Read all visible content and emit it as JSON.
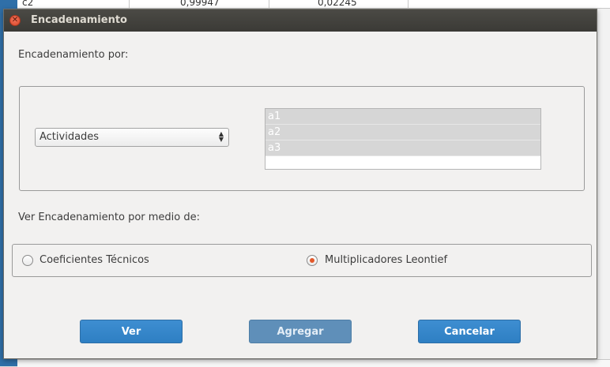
{
  "background": {
    "row_label": "c2",
    "cells": [
      "0,99947",
      "0,02245"
    ]
  },
  "dialog": {
    "title": "Encadenamiento",
    "close_icon": "close-icon",
    "encadenamiento_label": "Encadenamiento por:",
    "combo_value": "Actividades",
    "list_items": [
      "a1",
      "a2",
      "a3"
    ],
    "ver_label": "Ver Encadenamiento por medio de:",
    "radio_options": [
      "Coeficientes Técnicos",
      "Multiplicadores Leontief"
    ],
    "selected_radio": "Multiplicadores Leontief",
    "buttons": {
      "ver": "Ver",
      "agregar": "Agregar",
      "cancelar": "Cancelar"
    }
  },
  "colors": {
    "accent": "#2e7fc3",
    "radio_selected": "#e2582a"
  }
}
